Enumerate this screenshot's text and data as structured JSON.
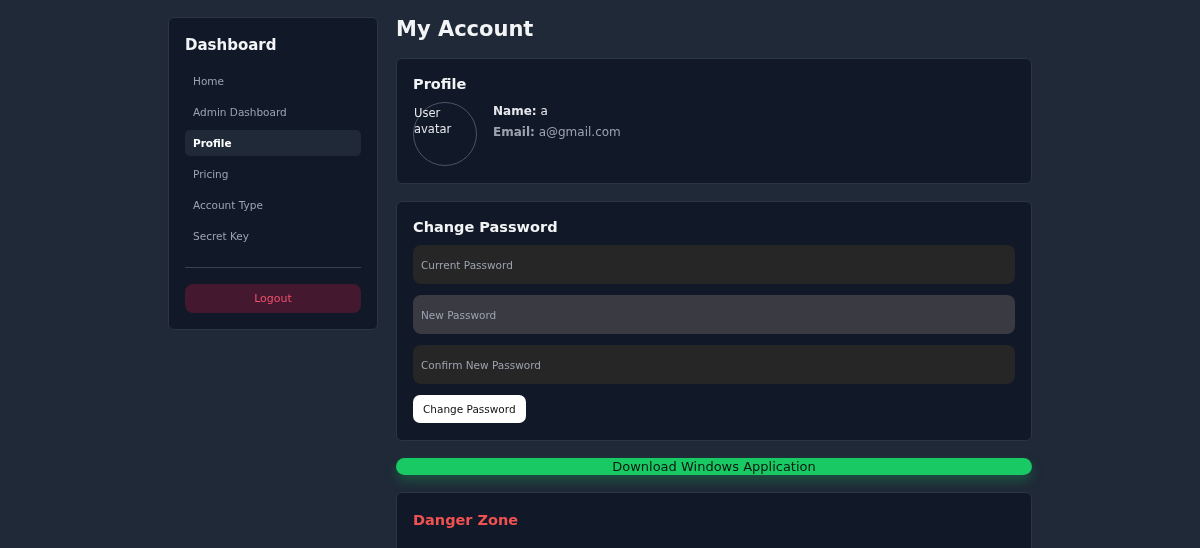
{
  "sidebar": {
    "title": "Dashboard",
    "items": [
      {
        "label": "Home",
        "selected": false
      },
      {
        "label": "Admin Dashboard",
        "selected": false
      },
      {
        "label": "Profile",
        "selected": true
      },
      {
        "label": "Pricing",
        "selected": false
      },
      {
        "label": "Account Type",
        "selected": false
      },
      {
        "label": "Secret Key",
        "selected": false
      }
    ],
    "logout": "Logout"
  },
  "page_title": "My Account",
  "profile": {
    "title": "Profile",
    "avatar_alt": "User avatar",
    "name_label": "Name:",
    "name": "a",
    "email_label": "Email:",
    "email": "a@gmail.com"
  },
  "change_password": {
    "title": "Change Password",
    "fields": [
      {
        "placeholder": "Current Password",
        "focused": false
      },
      {
        "placeholder": "New Password",
        "focused": true
      },
      {
        "placeholder": "Confirm New Password",
        "focused": false
      }
    ],
    "button": "Change Password"
  },
  "download_button": "Download Windows Application",
  "danger_zone": {
    "title": "Danger Zone"
  }
}
